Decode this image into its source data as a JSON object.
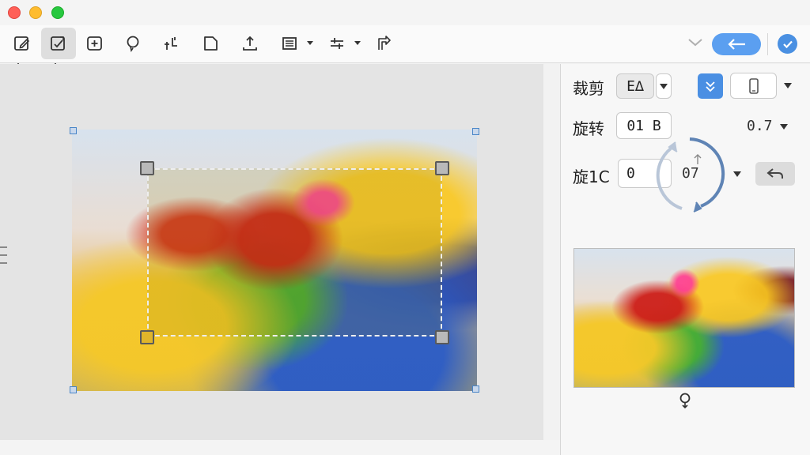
{
  "window": {
    "traffic_lights": [
      "close-button",
      "minimize-button",
      "zoom-button"
    ]
  },
  "toolbar": {
    "tools": [
      "edit-icon",
      "crop-edit-icon",
      "add-icon",
      "lasso-icon",
      "transform-icon",
      "page-icon",
      "upload-icon",
      "list-icon",
      "adjust-icon",
      "redo-icon"
    ],
    "active_tool": "crop-edit-icon",
    "back_button_color": "#5b9ff0",
    "confirm_color": "#4a90e2"
  },
  "panel": {
    "crop": {
      "label": "裁剪",
      "value": "E∆",
      "toggle_color": "#4a8fe3"
    },
    "rotate": {
      "label": "旋转",
      "value": "01 B",
      "right_value": "0.7"
    },
    "rotate2": {
      "label": "旋1C",
      "value": "0",
      "dial_value": "07"
    }
  },
  "preview": {
    "icon": "pin-icon"
  }
}
